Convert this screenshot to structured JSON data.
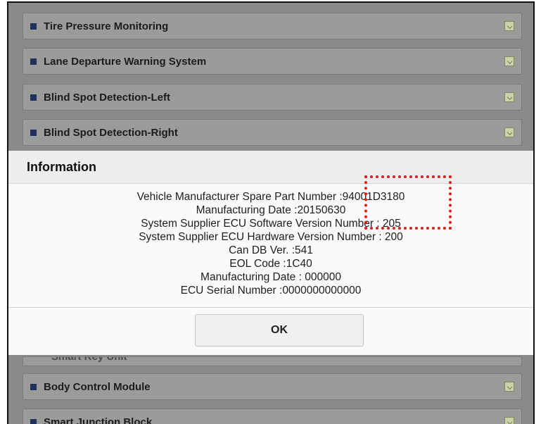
{
  "list": {
    "items": [
      {
        "label": "Tire Pressure Monitoring"
      },
      {
        "label": "Lane Departure Warning System"
      },
      {
        "label": "Blind Spot Detection-Left"
      },
      {
        "label": "Blind Spot Detection-Right"
      },
      {
        "label": "Smart Key Unit"
      },
      {
        "label": "Body Control Module"
      },
      {
        "label": "Smart Junction Block"
      }
    ],
    "bullet_color": "#1f2f5e",
    "background_color": "#8a8a8a"
  },
  "dialog": {
    "title": "Information",
    "lines": [
      "Vehicle Manufacturer Spare Part Number :94001D3180",
      "Manufacturing Date :20150630",
      "System Supplier ECU Software Version Number : 205",
      "System Supplier ECU Hardware Version Number : 200",
      "Can DB Ver. :541",
      "EOL Code :1C40",
      "Manufacturing Date : 000000",
      "ECU Serial Number :0000000000000"
    ],
    "ok_label": "OK",
    "highlight_color": "#e01b1b"
  }
}
